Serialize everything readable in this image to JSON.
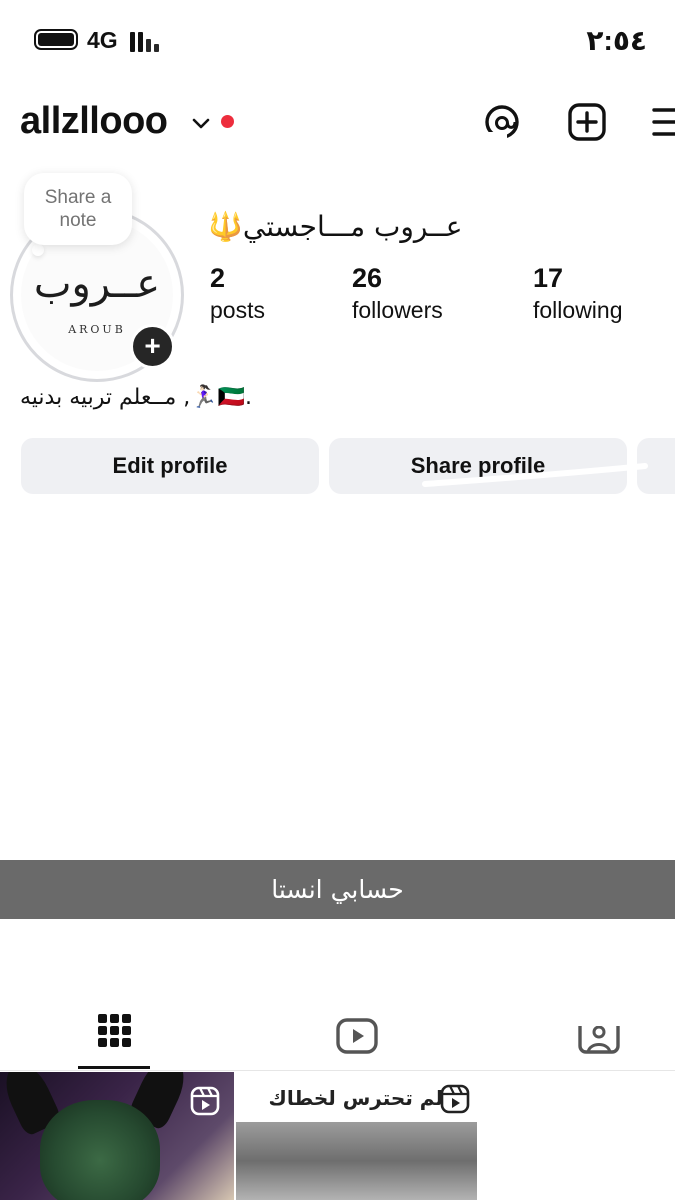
{
  "status_bar": {
    "network": "4G",
    "time": "٢:٥٤"
  },
  "header": {
    "username": "allzllooo"
  },
  "profile": {
    "note_prompt": "Share a\nnote",
    "logo_arabic": "عــروب",
    "logo_latin": "AROUB",
    "display_name": "عــروب مـــاجستي🔱",
    "stats": [
      {
        "value": "2",
        "label": "posts"
      },
      {
        "value": "26",
        "label": "followers"
      },
      {
        "value": "17",
        "label": "following"
      }
    ],
    "bio": "مــعلم تربيه بدنيه ,🏃🏻‍♀️🇰🇼."
  },
  "buttons": {
    "edit": "Edit profile",
    "share": "Share profile"
  },
  "caption": "حسابي انستا",
  "grid": {
    "post2_text": "لم تحترس لخطاك"
  },
  "colors": {
    "accent_red": "#ed2d3d",
    "button_bg": "#eff0f3",
    "caption_bg": "#6a6a6a"
  }
}
